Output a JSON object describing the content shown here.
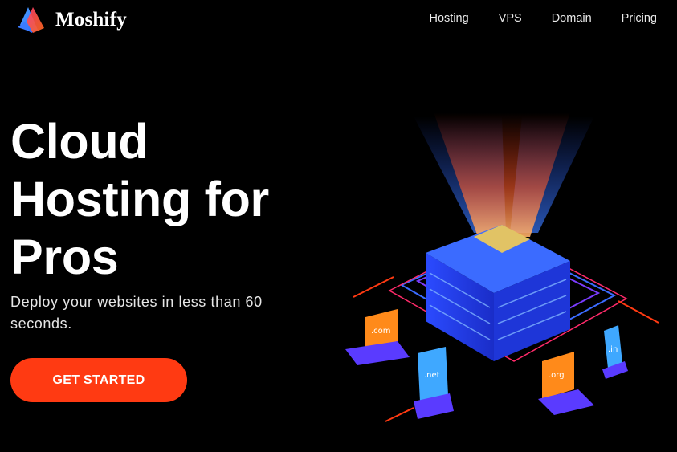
{
  "brand": {
    "name": "Moshify",
    "logo_icon": "moshify-logo-icon"
  },
  "nav": {
    "items": [
      "Hosting",
      "VPS",
      "Domain",
      "Pricing"
    ]
  },
  "hero": {
    "headline_lines": [
      "Cloud",
      "Hosting for",
      "Pros"
    ],
    "subtitle": "Deploy your websites in less than 60 seconds.",
    "cta_label": "GET STARTED",
    "accent_color": "#ff3a12",
    "illustration": {
      "icon": "cloud-server-illustration",
      "domains": [
        ".com",
        ".net",
        ".org",
        ".in"
      ]
    }
  },
  "colors": {
    "background": "#000000",
    "text": "#ffffff",
    "accent": "#ff3a12"
  }
}
